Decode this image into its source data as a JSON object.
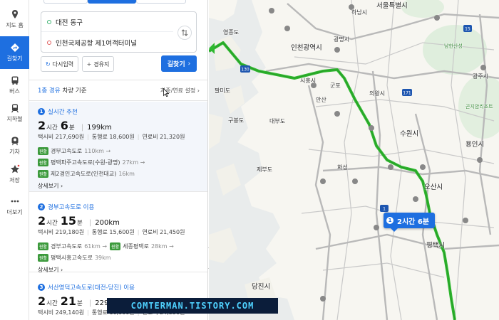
{
  "sidebar": {
    "items": [
      {
        "label": "지도 홈",
        "icon": "map-pin-icon",
        "active": false
      },
      {
        "label": "길찾기",
        "icon": "directions-icon",
        "active": true
      },
      {
        "label": "버스",
        "icon": "bus-icon",
        "active": false
      },
      {
        "label": "지하철",
        "icon": "subway-icon",
        "active": false
      },
      {
        "label": "기차",
        "icon": "train-icon",
        "active": false
      },
      {
        "label": "저장",
        "icon": "star-icon",
        "active": false
      },
      {
        "label": "더보기",
        "icon": "more-icon",
        "active": false
      }
    ]
  },
  "search": {
    "origin": "대전 동구",
    "destination": "인천국제공항 제1여객터미널",
    "reset_label": "다시입력",
    "via_label": "경유지",
    "search_label": "길찾기"
  },
  "criteria": {
    "highlight": "1종 경유",
    "suffix": "차량 기준",
    "settings_label": "차종/연료 설정"
  },
  "routes": [
    {
      "num": "1",
      "title": "실시간 추천",
      "hours": "2",
      "hour_unit": "시간",
      "minutes": "6",
      "min_unit": "분",
      "distance": "199km",
      "taxi": "택시비 217,690원",
      "toll": "통행료 18,600원",
      "fuel": "연료비 21,320원",
      "roads": [
        {
          "tag": "원활",
          "name": "경부고속도로",
          "len": "110km"
        },
        {
          "tag": "원활",
          "name": "평택파주고속도로(수원-광명)",
          "len": "27km"
        },
        {
          "tag": "원활",
          "name": "제2경인고속도로(인천대교)",
          "len": "16km"
        }
      ],
      "detail": "상세보기"
    },
    {
      "num": "2",
      "title": "경부고속도로 이용",
      "hours": "2",
      "hour_unit": "시간",
      "minutes": "15",
      "min_unit": "분",
      "distance": "200km",
      "taxi": "택시비 219,180원",
      "toll": "통행료 15,600원",
      "fuel": "연료비 21,450원",
      "roads": [
        {
          "tag": "원활",
          "name": "경부고속도로",
          "len": "61km",
          "tag2": "원활",
          "name2": "세종평택로",
          "len2": "28km"
        },
        {
          "tag": "원활",
          "name": "평택시흥고속도로",
          "len": "39km"
        }
      ],
      "detail": "상세보기"
    },
    {
      "num": "3",
      "title": "서산영덕고속도로(대전-당진) 이용",
      "hours": "2",
      "hour_unit": "시간",
      "minutes": "21",
      "min_unit": "분",
      "distance": "229km",
      "taxi": "택시비 249,140원",
      "toll": "통행료 16,000원",
      "fuel": "연료비 24,550원"
    }
  ],
  "map": {
    "labels": {
      "seoul": "서울특별시",
      "incheon": "인천광역시",
      "gwangmyeong": "광명시",
      "yeongjong": "영종도",
      "suwon": "수원시",
      "yongin": "용인시",
      "osan": "오산시",
      "pyeongtaek": "평택시",
      "dangjin": "당진시",
      "gwangju": "광주시",
      "hanam": "하남시",
      "uiwang": "의왕시",
      "gunpo": "군포",
      "siheung": "시흥시",
      "ansan": "안산",
      "hwaseong": "화성",
      "jebudo": "제부도",
      "daebudo": "대부도",
      "gudok": "구봉도",
      "namhansan": "남한산성",
      "gonjiam": "곤지암리조트",
      "palmido": "팔미도"
    },
    "tooltip_num": "1",
    "tooltip_time": "2시간 6분"
  },
  "watermark": "COMTERMAN.TISTORY.COM",
  "colors": {
    "accent": "#1e6fe0",
    "route": "#2fb82f",
    "sea": "#e9ecec",
    "land": "#f7f6f1"
  }
}
